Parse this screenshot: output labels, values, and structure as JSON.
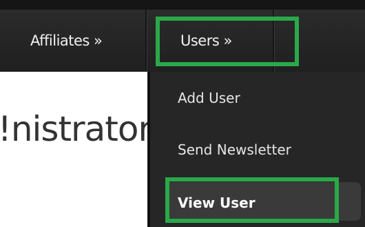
{
  "nav": {
    "affiliates_label": "Affiliates »",
    "users_label": "Users »"
  },
  "main": {
    "welcome_fragment": "nistrator!"
  },
  "dropdown": {
    "items": [
      {
        "label": "Add User"
      },
      {
        "label": "Send Newsletter"
      },
      {
        "label": "View User"
      }
    ]
  },
  "colors": {
    "highlight": "#2aa84a",
    "navbar": "#262626",
    "dropdown": "#262626"
  }
}
